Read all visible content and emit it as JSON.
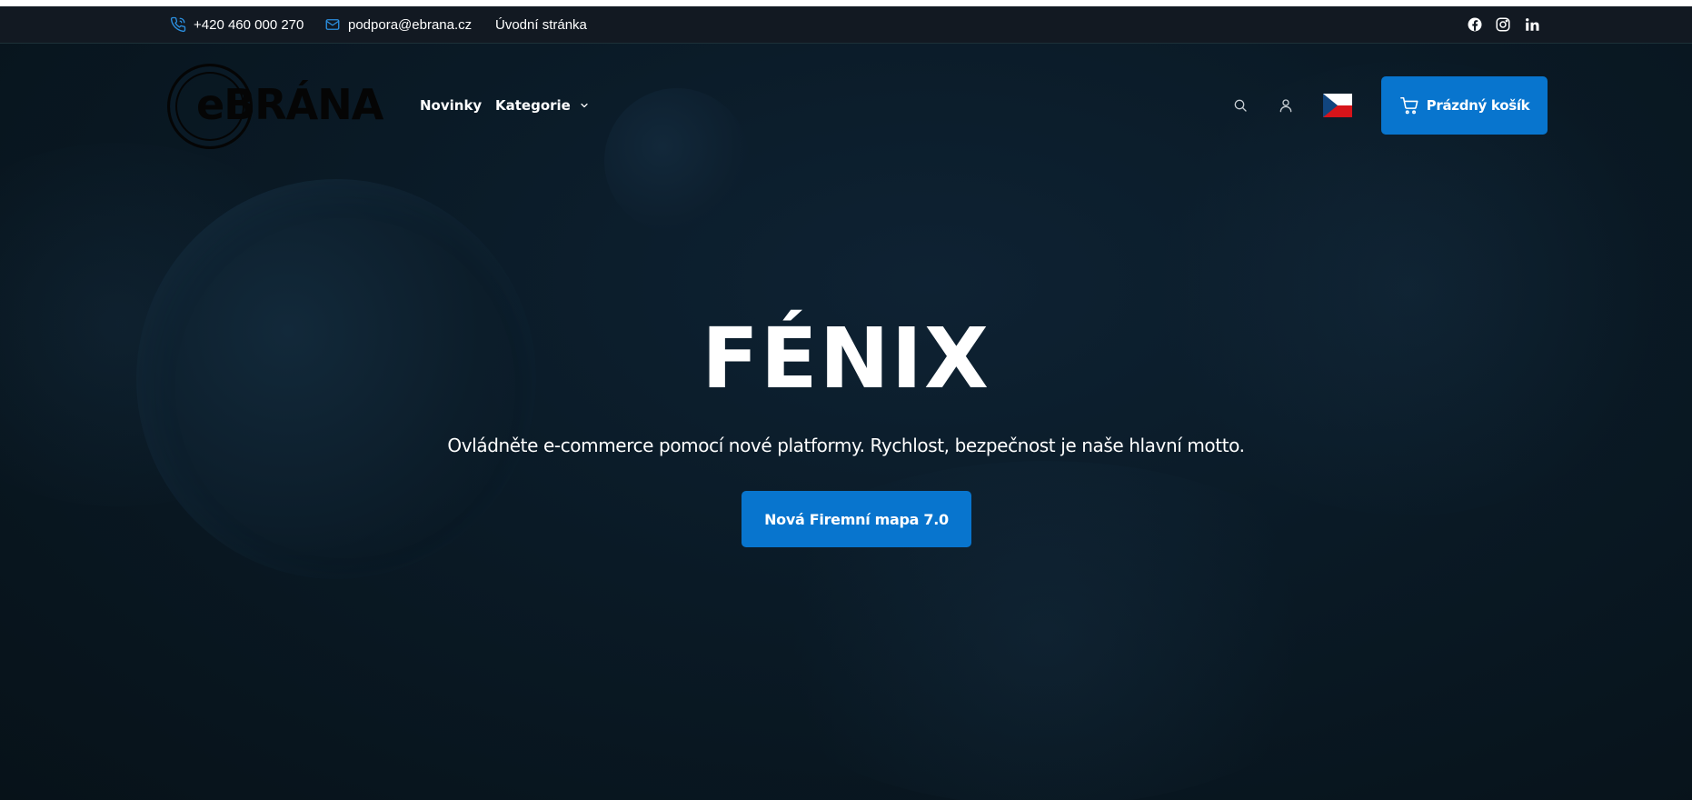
{
  "topbar": {
    "phone": "+420 460 000 270",
    "email": "podpora@ebrana.cz",
    "home_link": "Úvodní stránka",
    "social_icons": [
      "facebook-icon",
      "instagram-icon",
      "linkedin-icon"
    ]
  },
  "header": {
    "logo_text": "eBRÁNA",
    "nav": {
      "news": "Novinky",
      "categories": "Kategorie"
    },
    "icons": [
      "search-icon",
      "user-icon",
      "czech-flag-icon",
      "cart-icon"
    ],
    "cart_label": "Prázdný košík"
  },
  "hero": {
    "title": "FÉNIX",
    "subtitle": "Ovládněte e-commerce pomocí nové platformy. Rychlost, bezpečnost je naše hlavní motto.",
    "cta_label": "Nová Firemní mapa 7.0"
  },
  "colors": {
    "accent": "#0875ce",
    "background": "#0a1a26",
    "topbar": "#121922",
    "text": "#ffffff"
  }
}
